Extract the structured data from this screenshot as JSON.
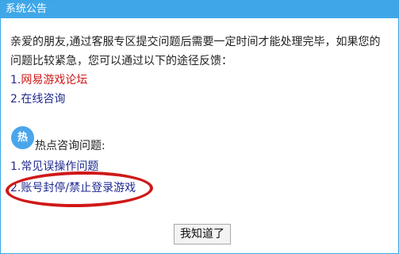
{
  "window": {
    "title": "系统公告"
  },
  "notice": {
    "text": "亲爱的朋友,通过客服专区提交问题后需要一定时间才能处理完毕，如果您的问题比较紧急，您可以通过以下的途径反馈："
  },
  "contact_links": [
    {
      "number": "1.",
      "label": "网易游戏论坛",
      "color": "#d01818"
    },
    {
      "number": "2.",
      "label": "在线咨询",
      "color": "#1f2a8f"
    }
  ],
  "hot_section": {
    "icon_text": "热",
    "heading": "热点咨询问题:"
  },
  "hot_links": [
    {
      "number": "1.",
      "label": "常见误操作问题"
    },
    {
      "number": "2.",
      "label": "账号封停/禁止登录游戏"
    }
  ],
  "buttons": {
    "ok_label": "我知道了"
  },
  "colors": {
    "titlebar": "#3fa7e8",
    "annotation_oval": "#d01818"
  }
}
